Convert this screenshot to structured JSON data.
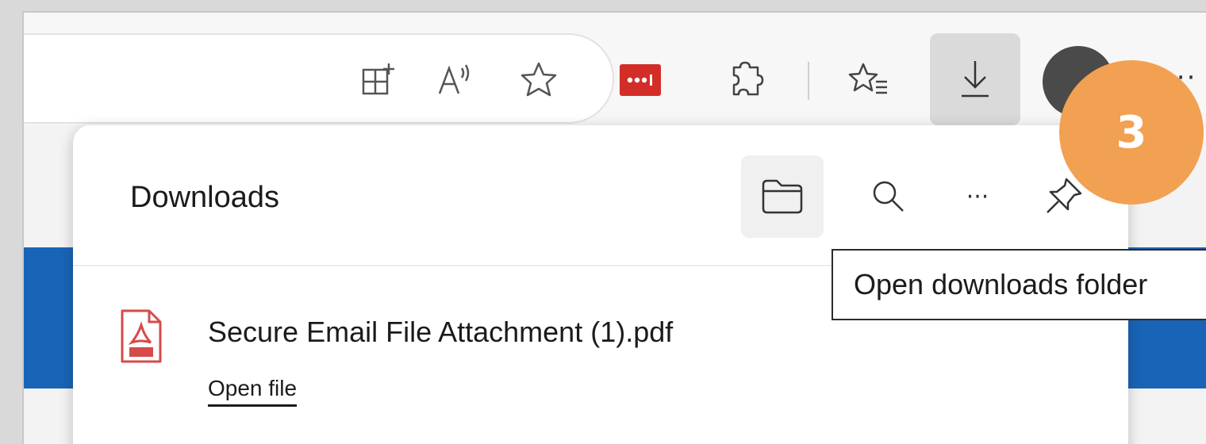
{
  "toolbar": {
    "icons": [
      "app-available-icon",
      "read-aloud-icon",
      "favorite-star-icon",
      "lastpass-extension-icon",
      "extensions-icon",
      "favorites-list-icon",
      "downloads-icon",
      "profile-avatar",
      "settings-more-icon"
    ],
    "more_label": "···"
  },
  "downloads_panel": {
    "title": "Downloads",
    "actions": [
      "open-downloads-folder-icon",
      "search-downloads-icon",
      "more-options-icon",
      "pin-icon"
    ],
    "more_label": "···",
    "items": [
      {
        "file_name": "Secure Email File Attachment (1).pdf",
        "action_label": "Open file",
        "icon": "pdf-file-icon"
      }
    ]
  },
  "tooltip": {
    "text": "Open downloads folder"
  },
  "annotation": {
    "step_number": "3",
    "color": "#f2a052"
  },
  "colors": {
    "accent_blue": "#1a64b7",
    "lastpass_red": "#d32d27"
  }
}
